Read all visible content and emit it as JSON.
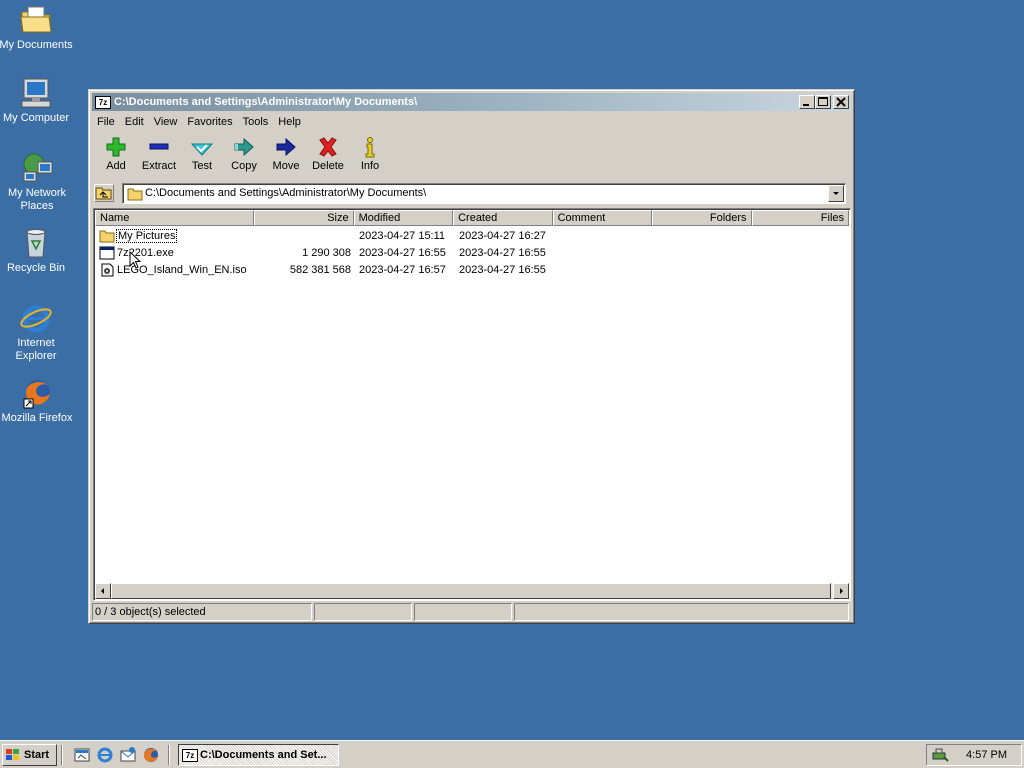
{
  "desktop": {
    "icons": [
      {
        "label": "My Documents"
      },
      {
        "label": "My Computer"
      },
      {
        "label": "My Network Places"
      },
      {
        "label": "Recycle Bin"
      },
      {
        "label": "Internet Explorer"
      },
      {
        "label": "Mozilla Firefox"
      }
    ]
  },
  "window": {
    "app_icon_text": "7z",
    "title": "C:\\Documents and Settings\\Administrator\\My Documents\\",
    "menu": [
      "File",
      "Edit",
      "View",
      "Favorites",
      "Tools",
      "Help"
    ],
    "toolbar": [
      {
        "label": "Add",
        "icon": "plus-icon"
      },
      {
        "label": "Extract",
        "icon": "minus-icon"
      },
      {
        "label": "Test",
        "icon": "check-icon"
      },
      {
        "label": "Copy",
        "icon": "copy-arrow-icon"
      },
      {
        "label": "Move",
        "icon": "move-arrow-icon"
      },
      {
        "label": "Delete",
        "icon": "delete-x-icon"
      },
      {
        "label": "Info",
        "icon": "info-icon"
      }
    ],
    "address": "C:\\Documents and Settings\\Administrator\\My Documents\\",
    "columns": [
      "Name",
      "Size",
      "Modified",
      "Created",
      "Comment",
      "Folders",
      "Files"
    ],
    "rows": [
      {
        "name": "My Pictures",
        "type": "folder",
        "size": "",
        "modified": "2023-04-27 15:11",
        "created": "2023-04-27 16:27"
      },
      {
        "name": "7z2201.exe",
        "type": "exe",
        "size": "1 290 308",
        "modified": "2023-04-27 16:55",
        "created": "2023-04-27 16:55"
      },
      {
        "name": "LEGO_Island_Win_EN.iso",
        "type": "iso",
        "size": "582 381 568",
        "modified": "2023-04-27 16:57",
        "created": "2023-04-27 16:55"
      }
    ],
    "status": "0 / 3 object(s) selected"
  },
  "taskbar": {
    "start_label": "Start",
    "task_label": "C:\\Documents and Set...",
    "task_icon_text": "7z",
    "clock": "4:57 PM"
  },
  "colors": {
    "desktop": "#3a6ea5",
    "window_face": "#d4d0c8",
    "title_gradient_start": "#7a8ea0",
    "title_gradient_end": "#c9d6df"
  }
}
